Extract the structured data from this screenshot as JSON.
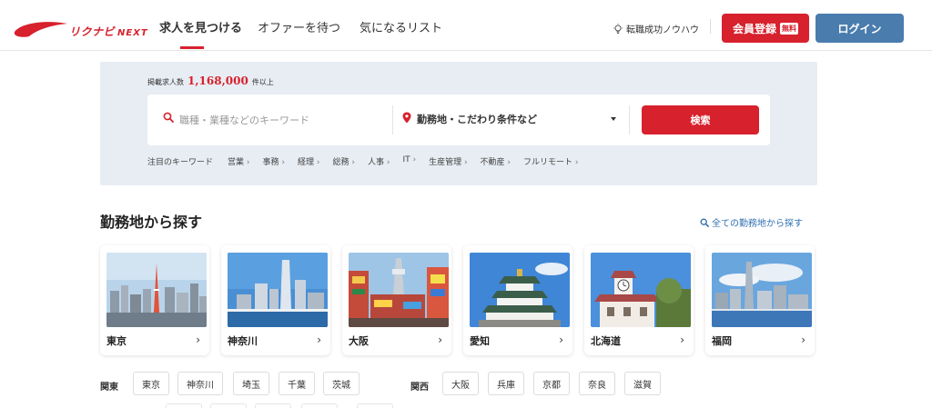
{
  "header": {
    "logo_text": "リクナビ",
    "logo_next": "NEXT",
    "nav": [
      {
        "label": "求人を見つける",
        "active": true
      },
      {
        "label": "オファーを待つ",
        "active": false
      },
      {
        "label": "気になるリスト",
        "active": false
      }
    ],
    "tip_label": "転職成功ノウハウ",
    "register_label": "会員登録",
    "register_badge": "無料",
    "login_label": "ログイン"
  },
  "search": {
    "count_prefix": "掲載求人数",
    "count_value": "1,168,000",
    "count_suffix": "件以上",
    "keyword_placeholder": "職種・業種などのキーワード",
    "location_label": "勤務地・こだわり条件など",
    "search_button": "検索",
    "keywords_label": "注目のキーワード",
    "keywords": [
      "営業",
      "事務",
      "経理",
      "総務",
      "人事",
      "IT",
      "生産管理",
      "不動産",
      "フルリモート"
    ]
  },
  "location_section": {
    "title": "勤務地から探す",
    "all_link": "全ての勤務地から探す",
    "cards": [
      {
        "label": "東京",
        "image": "tokyo-skyline"
      },
      {
        "label": "神奈川",
        "image": "yokohama-bay"
      },
      {
        "label": "大阪",
        "image": "osaka-tsutenkaku"
      },
      {
        "label": "愛知",
        "image": "nagoya-castle"
      },
      {
        "label": "北海道",
        "image": "sapporo-clock-tower"
      },
      {
        "label": "福岡",
        "image": "fukuoka-tower"
      }
    ],
    "regions": [
      {
        "label": "関東",
        "prefectures": [
          "東京",
          "神奈川",
          "埼玉",
          "千葉",
          "茨城"
        ]
      },
      {
        "label": "関西",
        "prefectures": [
          "大阪",
          "兵庫",
          "京都",
          "奈良",
          "滋賀"
        ]
      }
    ]
  },
  "colors": {
    "accent": "#d7212d",
    "login": "#4a7cae",
    "link": "#2f6fb0",
    "panel": "#e8edf3"
  }
}
